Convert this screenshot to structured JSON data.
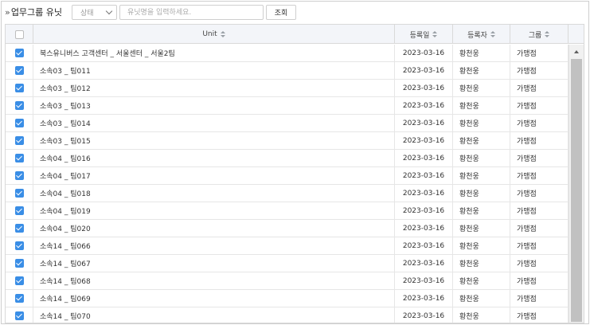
{
  "toolbar": {
    "title": "업무그룹 유닛",
    "status_select": "상태",
    "search_placeholder": "유닛명을 입력하세요.",
    "search_button": "조회"
  },
  "table": {
    "columns": [
      "Unit",
      "등록일",
      "등록자",
      "그룹"
    ],
    "rows": [
      {
        "unit": "북스유니버스 고객센터 _ 서울센터 _ 서울2팀",
        "date": "2023-03-16",
        "registrar": "황천웅",
        "group": "가맹점"
      },
      {
        "unit": "소속03 _ 팀011",
        "date": "2023-03-16",
        "registrar": "황천웅",
        "group": "가맹점"
      },
      {
        "unit": "소속03 _ 팀012",
        "date": "2023-03-16",
        "registrar": "황천웅",
        "group": "가맹점"
      },
      {
        "unit": "소속03 _ 팀013",
        "date": "2023-03-16",
        "registrar": "황천웅",
        "group": "가맹점"
      },
      {
        "unit": "소속03 _ 팀014",
        "date": "2023-03-16",
        "registrar": "황천웅",
        "group": "가맹점"
      },
      {
        "unit": "소속03 _ 팀015",
        "date": "2023-03-16",
        "registrar": "황천웅",
        "group": "가맹점"
      },
      {
        "unit": "소속04 _ 팀016",
        "date": "2023-03-16",
        "registrar": "황천웅",
        "group": "가맹점"
      },
      {
        "unit": "소속04 _ 팀017",
        "date": "2023-03-16",
        "registrar": "황천웅",
        "group": "가맹점"
      },
      {
        "unit": "소속04 _ 팀018",
        "date": "2023-03-16",
        "registrar": "황천웅",
        "group": "가맹점"
      },
      {
        "unit": "소속04 _ 팀019",
        "date": "2023-03-16",
        "registrar": "황천웅",
        "group": "가맹점"
      },
      {
        "unit": "소속04 _ 팀020",
        "date": "2023-03-16",
        "registrar": "황천웅",
        "group": "가맹점"
      },
      {
        "unit": "소속14 _ 팀066",
        "date": "2023-03-16",
        "registrar": "황천웅",
        "group": "가맹점"
      },
      {
        "unit": "소속14 _ 팀067",
        "date": "2023-03-16",
        "registrar": "황천웅",
        "group": "가맹점"
      },
      {
        "unit": "소속14 _ 팀068",
        "date": "2023-03-16",
        "registrar": "황천웅",
        "group": "가맹점"
      },
      {
        "unit": "소속14 _ 팀069",
        "date": "2023-03-16",
        "registrar": "황천웅",
        "group": "가맹점"
      },
      {
        "unit": "소속14 _ 팀070",
        "date": "2023-03-16",
        "registrar": "황천웅",
        "group": "가맹점"
      }
    ]
  },
  "icons": {
    "title_icon": "double-chevron-right-icon",
    "select_icon": "chevron-down-icon",
    "sort_icon": "sort-icon",
    "checkbox_icon": "checkbox-checked-icon"
  },
  "colors": {
    "checkbox": "#3a8ee6",
    "header_bg": "#f3f5f9",
    "border": "#d9d9d9"
  }
}
